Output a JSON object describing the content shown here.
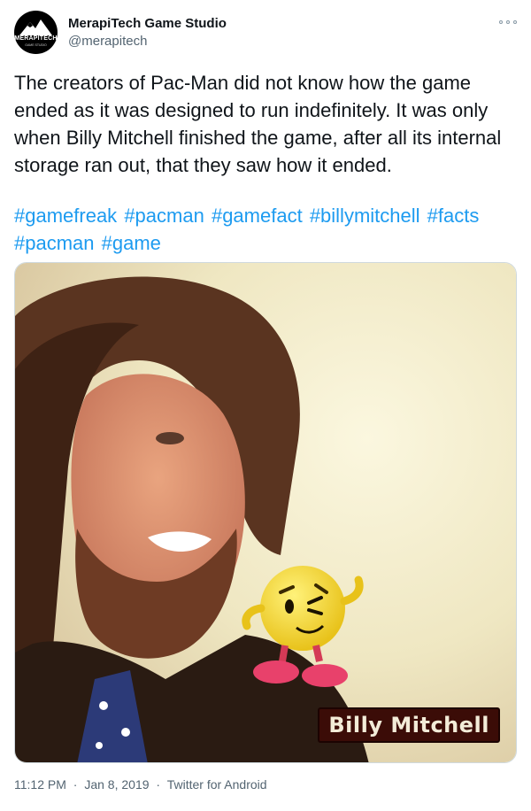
{
  "tweet": {
    "author": {
      "name": "MerapiTech Game Studio",
      "handle": "@merapitech",
      "avatar_text": "MERAPITECH",
      "avatar_subtext": "GAME STUDIO"
    },
    "text": "The creators of Pac-Man did not know how the game ended as it was designed to run indefinitely. It was only when Billy Mitchell finished the game, after all its internal storage ran out, that they saw how it ended.",
    "hashtags": [
      "#gamefreak",
      "#pacman",
      "#gamefact",
      "#billymitchell",
      "#facts",
      "#pacman",
      "#game"
    ],
    "image_caption": "Billy Mitchell",
    "time": "11:12 PM",
    "date": "Jan 8, 2019",
    "separator": "·",
    "source": "Twitter for Android"
  },
  "colors": {
    "text": "#0f1419",
    "secondary": "#536471",
    "link": "#1d9bf0",
    "caption_bg": "#3b0c07"
  },
  "icons": {
    "more": "more-options-icon",
    "avatar": "mountain-logo-icon"
  }
}
